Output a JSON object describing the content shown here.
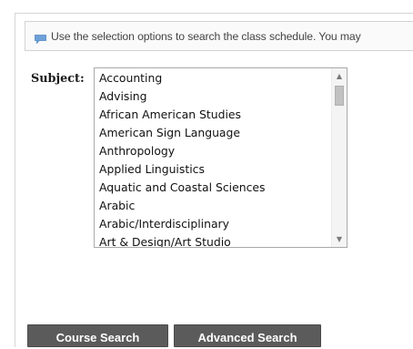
{
  "info": {
    "message": "Use the selection options to search the class schedule. You may",
    "icon": "speech-bubble-icon",
    "icon_color": "#6ea0d8"
  },
  "subject": {
    "label": "Subject:",
    "options": [
      "Accounting",
      "Advising",
      "African American Studies",
      "American Sign Language",
      "Anthropology",
      "Applied Linguistics",
      "Aquatic and Coastal Sciences",
      "Arabic",
      "Arabic/Interdisciplinary",
      "Art & Design/Art Studio"
    ]
  },
  "buttons": {
    "course_search": "Course Search",
    "advanced_search": "Advanced Search",
    "color": "#5b5b5b"
  }
}
